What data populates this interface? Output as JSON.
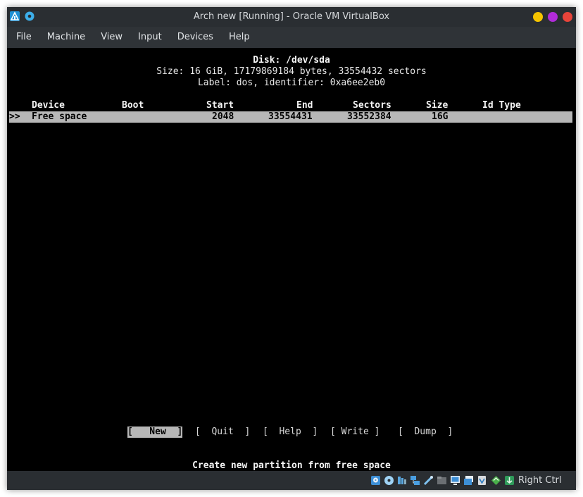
{
  "window": {
    "title": "Arch new [Running] - Oracle VM VirtualBox",
    "controls": {
      "minimize_color": "#f5c400",
      "maximize_color": "#b12bd9",
      "close_color": "#e8443a"
    }
  },
  "menu": [
    "File",
    "Machine",
    "View",
    "Input",
    "Devices",
    "Help"
  ],
  "terminal": {
    "disk_line": "Disk: /dev/sda",
    "size_line": "Size: 16 GiB, 17179869184 bytes, 33554432 sectors",
    "label_line": "Label: dos, identifier: 0xa6ee2eb0",
    "columns": {
      "device": "Device",
      "boot": "Boot",
      "start": "Start",
      "end": "End",
      "sectors": "Sectors",
      "size": "Size",
      "id_type": "Id Type"
    },
    "selected_row": {
      "marker": ">>",
      "device": "Free space",
      "start": "2048",
      "end": "33554431",
      "sectors": "33552384",
      "size": "16G"
    },
    "buttons": {
      "new": "[   New  ]",
      "quit": "[  Quit  ]",
      "help": "[  Help  ]",
      "write": "[ Write ]",
      "dump": "[  Dump  ]"
    },
    "hint": "Create new partition from free space"
  },
  "statusbar": {
    "host_key": "Right Ctrl",
    "icons": [
      "hard-disk-icon",
      "optical-drive-icon",
      "audio-icon",
      "network-icon",
      "usb-icon",
      "shared-folders-icon",
      "display-icon",
      "recording-icon",
      "cpu-icon",
      "mouse-integration-icon",
      "keyboard-icon"
    ]
  }
}
